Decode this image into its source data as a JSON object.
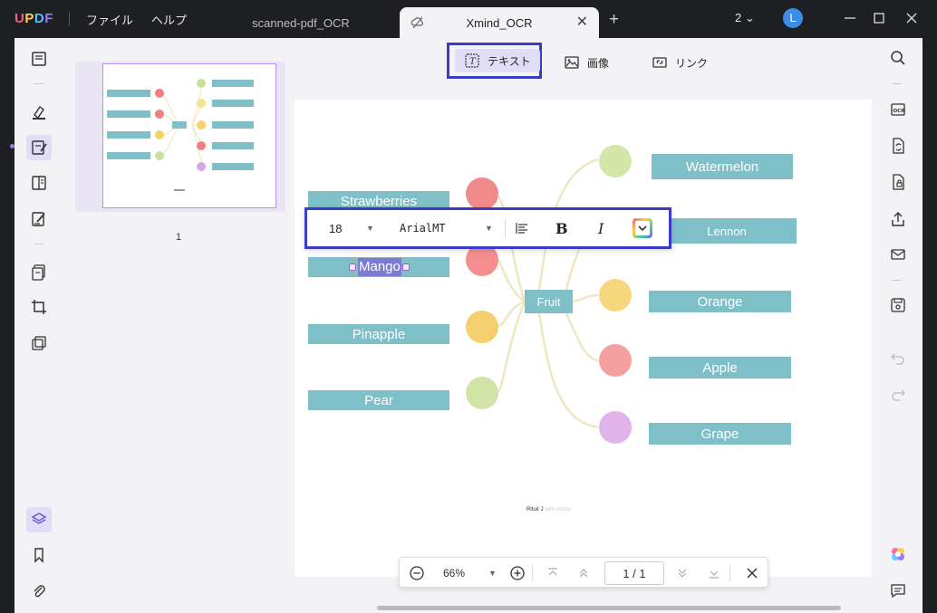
{
  "app": {
    "logo": "UPDF",
    "menu": [
      "ファイル",
      "ヘルプ"
    ],
    "tabs": [
      {
        "label": "scanned-pdf_OCR",
        "active": false
      },
      {
        "label": "Xmind_OCR",
        "active": true
      }
    ],
    "window_count": "2",
    "user_initial": "L"
  },
  "ribbon": {
    "text_label": "テキスト",
    "image_label": "画像",
    "link_label": "リンク"
  },
  "thumbnails": {
    "page_number": "1"
  },
  "mindmap": {
    "center": "Fruit",
    "left_items": [
      "Strawberries",
      "Mango",
      "Pinapple",
      "Pear"
    ],
    "right_items": [
      "Watermelon",
      "Lennon",
      "Orange",
      "Apple",
      "Grape"
    ],
    "footer_main": "Rituir J",
    "footer_faint": "with xmind"
  },
  "edit_toolbar": {
    "font_size": "18",
    "font_name": "ArialMT",
    "bold_label": "B",
    "italic_label": "I"
  },
  "zoom": {
    "level": "66%",
    "page_display": "1 / 1"
  },
  "colors": {
    "accent": "#3b3bc7",
    "box_fill": "#7fbfc8",
    "selection_purple": "#7b7bd6"
  }
}
